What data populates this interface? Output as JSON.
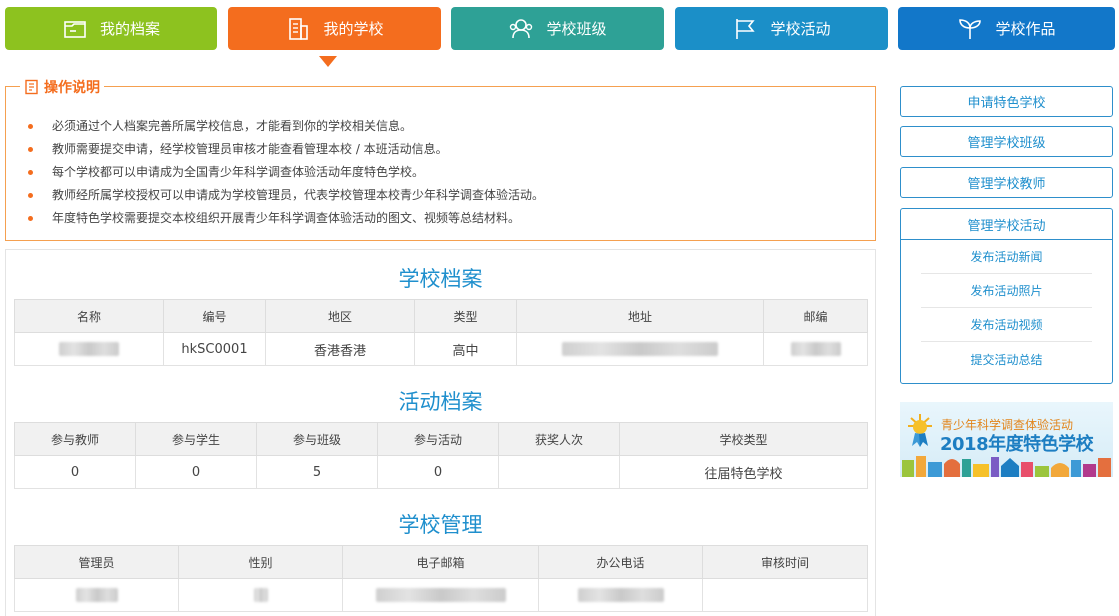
{
  "tabs": [
    {
      "label": "我的档案",
      "icon": "folder-icon",
      "color": "#8dc21f"
    },
    {
      "label": "我的学校",
      "icon": "building-icon",
      "color": "#f46d1e"
    },
    {
      "label": "学校班级",
      "icon": "group-icon",
      "color": "#2ea196"
    },
    {
      "label": "学校活动",
      "icon": "flag-icon",
      "color": "#1b8fc8"
    },
    {
      "label": "学校作品",
      "icon": "sprout-icon",
      "color": "#1277c9"
    }
  ],
  "notice": {
    "title": "操作说明",
    "items": [
      "必须通过个人档案完善所属学校信息，才能看到你的学校相关信息。",
      "教师需要提交申请，经学校管理员审核才能查看管理本校 / 本班活动信息。",
      "每个学校都可以申请成为全国青少年科学调查体验活动年度特色学校。",
      "教师经所属学校授权可以申请成为学校管理员，代表学校管理本校青少年科学调查体验活动。",
      "年度特色学校需要提交本校组织开展青少年科学调查体验活动的图文、视频等总结材料。"
    ]
  },
  "school_profile": {
    "title": "学校档案",
    "headers": [
      "名称",
      "编号",
      "地区",
      "类型",
      "地址",
      "邮编"
    ],
    "row": {
      "code": "hkSC0001",
      "region": "香港香港",
      "type": "高中"
    }
  },
  "activity_profile": {
    "title": "活动档案",
    "headers": [
      "参与教师",
      "参与学生",
      "参与班级",
      "参与活动",
      "获奖人次",
      "学校类型"
    ],
    "row": [
      "0",
      "0",
      "5",
      "0",
      "",
      "往届特色学校"
    ]
  },
  "school_admin": {
    "title": "学校管理",
    "headers": [
      "管理员",
      "性别",
      "电子邮箱",
      "办公电话",
      "审核时间"
    ]
  },
  "sidebar": {
    "buttons": [
      "申请特色学校",
      "管理学校班级",
      "管理学校教师"
    ],
    "group_title": "管理学校活动",
    "sub_items": [
      "发布活动新闻",
      "发布活动照片",
      "发布活动视频",
      "提交活动总结"
    ]
  },
  "banner": {
    "line1": "青少年科学调查体验活动",
    "line2": "2018年度特色学校"
  }
}
